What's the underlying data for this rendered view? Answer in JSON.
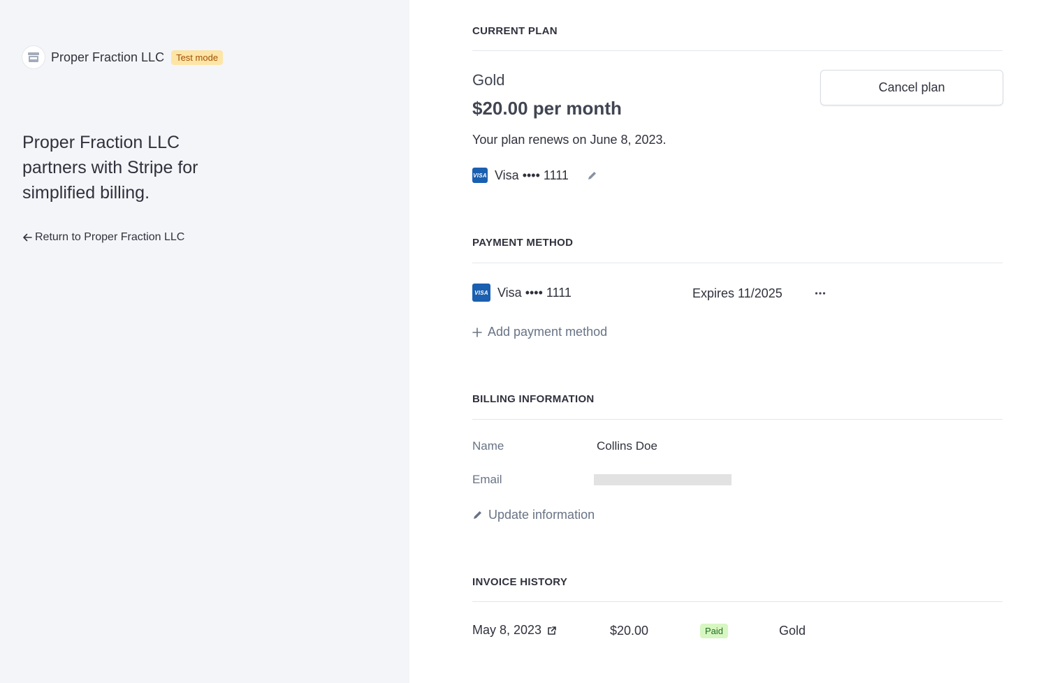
{
  "brand": {
    "name": "Proper Fraction LLC",
    "test_badge": "Test mode",
    "tagline": "Proper Fraction LLC partners with Stripe for simplified billing.",
    "return_link": "Return to Proper Fraction LLC"
  },
  "current_plan": {
    "section_title": "CURRENT PLAN",
    "plan_name": "Gold",
    "price": "$20.00 per month",
    "renew_text": "Your plan renews on June 8, 2023.",
    "cancel_label": "Cancel plan",
    "card_label": "Visa •••• 1111"
  },
  "payment_method": {
    "section_title": "PAYMENT METHOD",
    "card_label": "Visa •••• 1111",
    "expiry": "Expires 11/2025",
    "add_label": "Add payment method"
  },
  "billing_info": {
    "section_title": "BILLING INFORMATION",
    "name_label": "Name",
    "name_value": "Collins Doe",
    "email_label": "Email",
    "update_label": "Update information"
  },
  "invoice_history": {
    "section_title": "INVOICE HISTORY",
    "rows": [
      {
        "date": "May 8, 2023",
        "amount": "$20.00",
        "status": "Paid",
        "plan": "Gold"
      }
    ]
  },
  "colors": {
    "left_panel_bg": "#f4f5f8",
    "test_badge_bg": "#fde5a6",
    "visa_blue": "#1a5fb0",
    "paid_badge_bg": "#d7f7c2"
  },
  "icons": {
    "brand": "storefront-icon",
    "return": "arrow-left-icon",
    "edit": "pencil-icon",
    "more": "ellipsis-icon",
    "add": "plus-icon",
    "external": "external-link-icon"
  }
}
